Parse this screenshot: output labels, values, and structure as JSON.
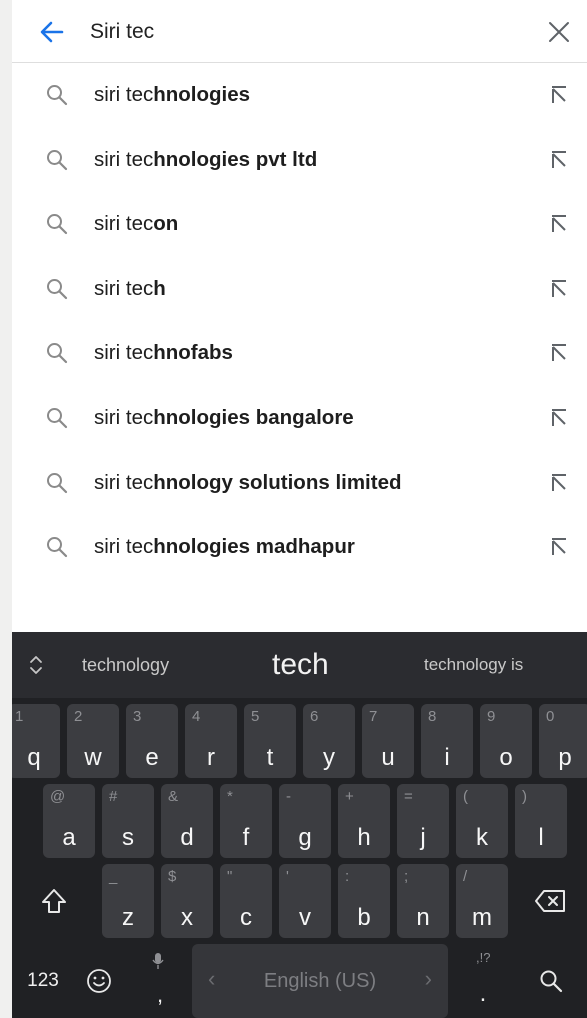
{
  "search": {
    "query": "Siri tec"
  },
  "suggestions": [
    {
      "prefix": "siri tec",
      "completion": "hnologies"
    },
    {
      "prefix": "siri tec",
      "completion": "hnologies pvt ltd"
    },
    {
      "prefix": "siri tec",
      "completion": "on"
    },
    {
      "prefix": "siri tec",
      "completion": "h"
    },
    {
      "prefix": "siri tec",
      "completion": "hnofabs"
    },
    {
      "prefix": "siri tec",
      "completion": "hnologies bangalore"
    },
    {
      "prefix": "siri tec",
      "completion": "hnology solutions limited"
    },
    {
      "prefix": "siri tec",
      "completion": "hnologies madhapur"
    }
  ],
  "keyboard": {
    "predictions": {
      "left": "technology",
      "middle": "tech",
      "right": "technology is"
    },
    "row1": [
      {
        "hint": "1",
        "key": "q"
      },
      {
        "hint": "2",
        "key": "w"
      },
      {
        "hint": "3",
        "key": "e"
      },
      {
        "hint": "4",
        "key": "r"
      },
      {
        "hint": "5",
        "key": "t"
      },
      {
        "hint": "6",
        "key": "y"
      },
      {
        "hint": "7",
        "key": "u"
      },
      {
        "hint": "8",
        "key": "i"
      },
      {
        "hint": "9",
        "key": "o"
      },
      {
        "hint": "0",
        "key": "p"
      }
    ],
    "row2": [
      {
        "hint": "@",
        "key": "a"
      },
      {
        "hint": "#",
        "key": "s"
      },
      {
        "hint": "&",
        "key": "d"
      },
      {
        "hint": "*",
        "key": "f"
      },
      {
        "hint": "-",
        "key": "g"
      },
      {
        "hint": "+",
        "key": "h"
      },
      {
        "hint": "=",
        "key": "j"
      },
      {
        "hint": "(",
        "key": "k"
      },
      {
        "hint": ")",
        "key": "l"
      }
    ],
    "row3": [
      {
        "hint": "_",
        "key": "z"
      },
      {
        "hint": "$",
        "key": "x"
      },
      {
        "hint": "\"",
        "key": "c"
      },
      {
        "hint": "'",
        "key": "v"
      },
      {
        "hint": ":",
        "key": "b"
      },
      {
        "hint": ";",
        "key": "n"
      },
      {
        "hint": "/",
        "key": "m"
      }
    ],
    "bottom": {
      "numbers_label": "123",
      "comma_key": ",",
      "space_label": "English (US)",
      "period_hint": ",!?",
      "period_key": "."
    }
  },
  "colors": {
    "accent": "#1a73e8",
    "keyboard_bg": "#202124",
    "key_bg": "#3c3d41"
  }
}
